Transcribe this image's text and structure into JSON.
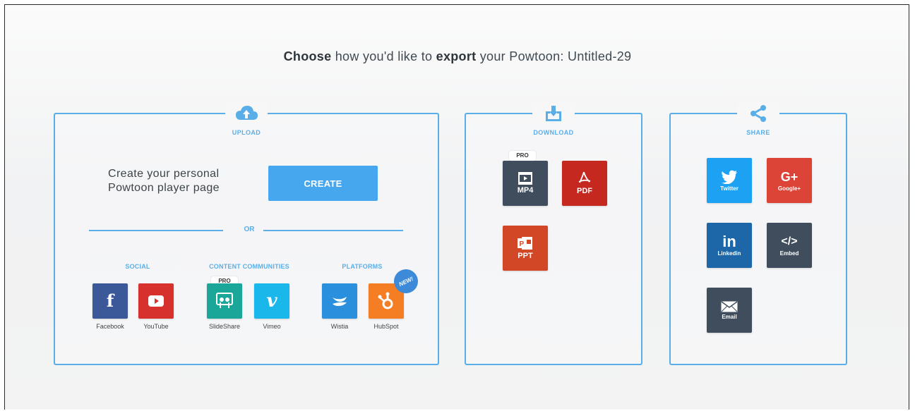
{
  "headline": {
    "choose": "Choose",
    "part1": " how you'd like to ",
    "export": "export",
    "part2": " your Powtoon: Untitled-29"
  },
  "upload": {
    "title": "UPLOAD",
    "create_text_line1": "Create your personal",
    "create_text_line2": "Powtoon player page",
    "create_label": "CREATE",
    "or_label": "OR",
    "categories": {
      "social": "SOCIAL",
      "content": "CONTENT COMMUNITIES",
      "platforms": "PLATFORMS"
    },
    "items": {
      "facebook": "Facebook",
      "youtube": "YouTube",
      "slideshare": "SlideShare",
      "vimeo": "Vimeo",
      "wistia": "Wistia",
      "hubspot": "HubSpot"
    },
    "pro_tag": "PRO",
    "new_badge": "NEW!"
  },
  "download": {
    "title": "DOWNLOAD",
    "pro_tag": "PRO",
    "items": {
      "mp4": "MP4",
      "pdf": "PDF",
      "ppt": "PPT"
    }
  },
  "share": {
    "title": "SHARE",
    "items": {
      "twitter": "Twitter",
      "google": "Google+",
      "google_glyph": "G+",
      "linkedin": "Linkedin",
      "linkedin_glyph": "in",
      "embed": "Embed",
      "embed_glyph": "</>",
      "email": "Email"
    }
  },
  "colors": {
    "accent": "#5aaee8",
    "create_button": "#46a7ef",
    "facebook": "#3b5998",
    "youtube": "#d6312c",
    "slideshare": "#1aa79a",
    "vimeo": "#1ab7ea",
    "wistia": "#2a8fdc",
    "hubspot": "#f57d24",
    "mp4": "#3f4d5c",
    "pdf": "#c4281f",
    "ppt": "#d24726",
    "twitter": "#1da1f2",
    "google": "#db4437",
    "linkedin": "#1d67a8",
    "embed": "#3f4d5c",
    "email": "#3f4d5c"
  }
}
